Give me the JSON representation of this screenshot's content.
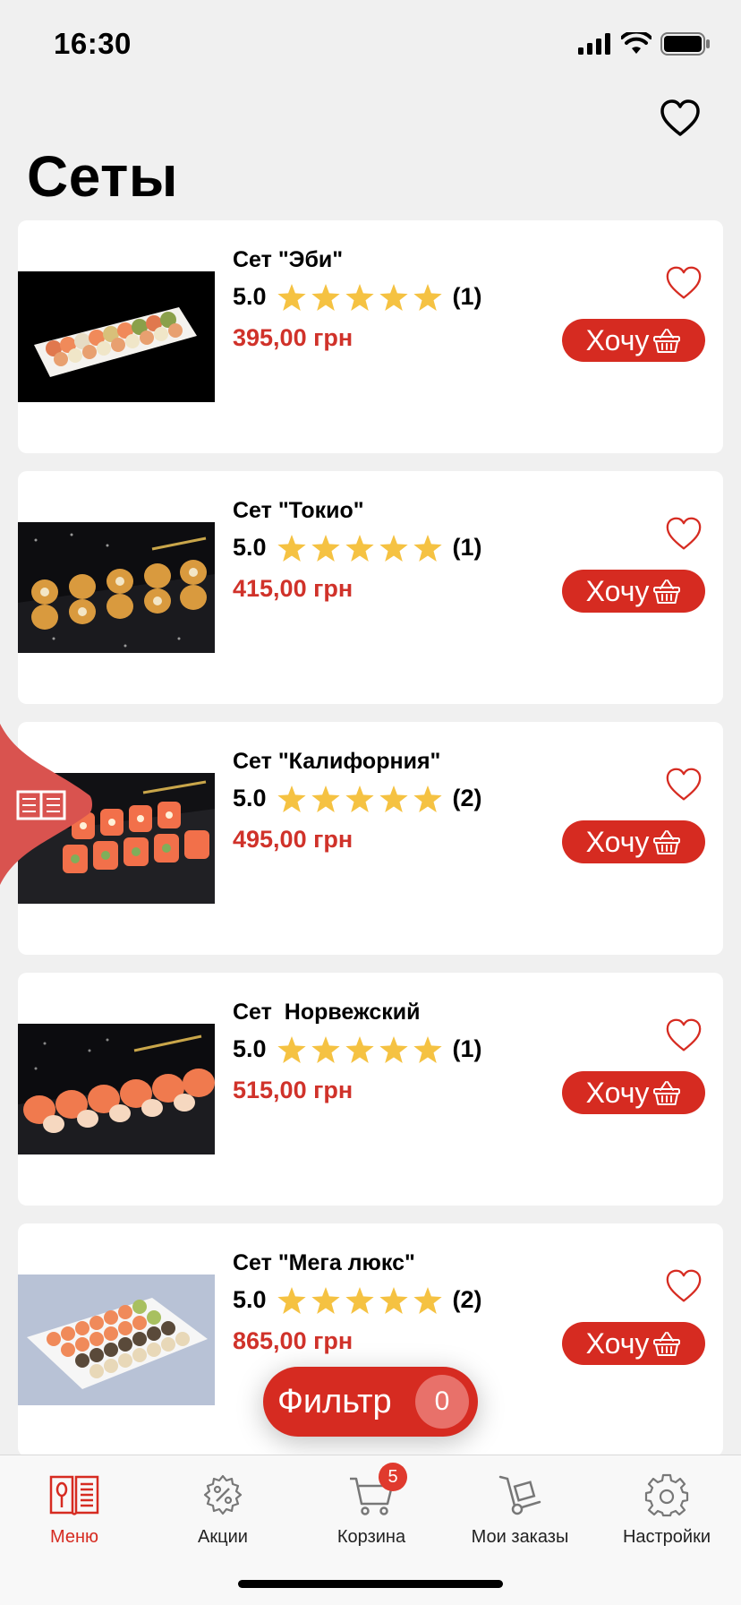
{
  "status": {
    "time": "16:30"
  },
  "page": {
    "title": "Сеты"
  },
  "products": [
    {
      "name": "Сет \"Эби\"",
      "rating": "5.0",
      "reviews": "(1)",
      "price": "395,00 грн",
      "button": "Хочу"
    },
    {
      "name": "Сет \"Токио\"",
      "rating": "5.0",
      "reviews": "(1)",
      "price": "415,00 грн",
      "button": "Хочу"
    },
    {
      "name": "Сет \"Калифорния\"",
      "rating": "5.0",
      "reviews": "(2)",
      "price": "495,00 грн",
      "button": "Хочу"
    },
    {
      "name": "Сет  Норвежский",
      "rating": "5.0",
      "reviews": "(1)",
      "price": "515,00 грн",
      "button": "Хочу"
    },
    {
      "name": "Сет \"Мега люкс\"",
      "rating": "5.0",
      "reviews": "(2)",
      "price": "865,00 грн",
      "button": "Хочу"
    }
  ],
  "filter": {
    "label": "Фильтр",
    "count": "0"
  },
  "tabs": [
    {
      "label": "Меню",
      "icon": "menu-book-spoon-icon",
      "active": true
    },
    {
      "label": "Акции",
      "icon": "percent-gear-icon"
    },
    {
      "label": "Корзина",
      "icon": "cart-icon",
      "badge": "5"
    },
    {
      "label": "Мои заказы",
      "icon": "hand-truck-icon"
    },
    {
      "label": "Настройки",
      "icon": "gear-icon"
    }
  ],
  "colors": {
    "accent": "#d62b21",
    "price": "#d0322a",
    "star": "#f5c242",
    "background": "#f0f0f0"
  }
}
